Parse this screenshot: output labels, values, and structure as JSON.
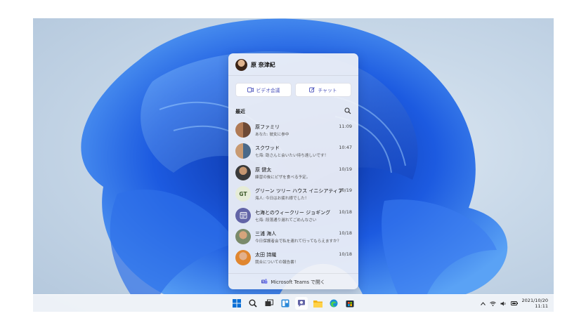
{
  "panel": {
    "user_name": "原 奈津紀",
    "video_button": "ビデオ会議",
    "chat_button": "チャット",
    "recent_label": "最近",
    "footer_label": "Microsoft Teams で開く",
    "contacts": [
      {
        "name": "原ファミリ",
        "message": "あなた: 彼女に参中",
        "time": "11:09",
        "avatar": "group"
      },
      {
        "name": "スクワッド",
        "message": "七海: 助さんと会いたい待ち遠しいです！",
        "time": "10:47",
        "avatar": "group"
      },
      {
        "name": "原 健太",
        "message": "練習の後にピザを食べる予定。",
        "time": "10/19",
        "avatar": "person"
      },
      {
        "name": "グリーン ツリー ハウス イニシアティブ",
        "message": "海人: 今日はお疲れ様でした！",
        "time": "10/19",
        "avatar": "initials",
        "initials": "GT"
      },
      {
        "name": "七海とのウィークリー ジョギング",
        "message": "七海: 段落通り遅れてごめんなさい",
        "time": "10/18",
        "avatar": "calendar"
      },
      {
        "name": "三浦 海人",
        "message": "今日保護者会で私を連れて行ってもらえますか？",
        "time": "10/18",
        "avatar": "person"
      },
      {
        "name": "太田 詩織",
        "message": "競合についての報告書！",
        "time": "10/18",
        "avatar": "person"
      }
    ]
  },
  "taskbar": {
    "date": "2021/10/20",
    "time": "11:11",
    "icons": [
      "windows-start-icon",
      "search-icon",
      "task-view-icon",
      "widgets-icon",
      "teams-chat-icon",
      "file-explorer-icon",
      "edge-icon",
      "store-icon"
    ]
  },
  "colors": {
    "accent": "#4b53bc",
    "bloom": "#1e5bd8"
  }
}
